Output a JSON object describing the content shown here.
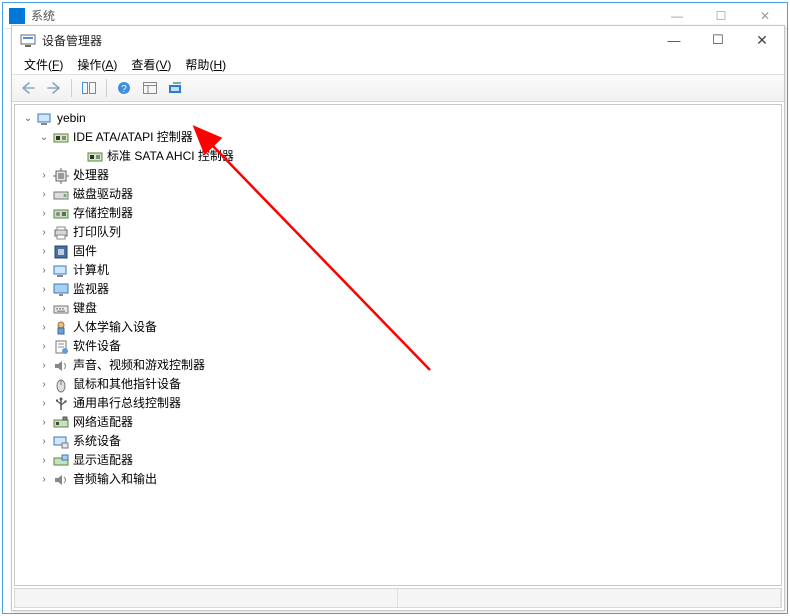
{
  "outer": {
    "title": "系统"
  },
  "inner": {
    "title": "设备管理器"
  },
  "menu": {
    "file": {
      "label": "文件",
      "accel": "F"
    },
    "action": {
      "label": "操作",
      "accel": "A"
    },
    "view": {
      "label": "查看",
      "accel": "V"
    },
    "help": {
      "label": "帮助",
      "accel": "H"
    }
  },
  "tree": {
    "root": "yebin",
    "items": [
      {
        "id": "ide",
        "label": "IDE ATA/ATAPI 控制器",
        "expanded": true,
        "icon": "ide-icon",
        "children": [
          {
            "id": "sata",
            "label": "标准 SATA AHCI 控制器",
            "icon": "ide-icon"
          }
        ]
      },
      {
        "id": "cpu",
        "label": "处理器",
        "icon": "cpu-icon"
      },
      {
        "id": "disk",
        "label": "磁盘驱动器",
        "icon": "disk-icon"
      },
      {
        "id": "storage",
        "label": "存储控制器",
        "icon": "storage-icon"
      },
      {
        "id": "printq",
        "label": "打印队列",
        "icon": "printer-icon"
      },
      {
        "id": "firmware",
        "label": "固件",
        "icon": "firmware-icon"
      },
      {
        "id": "computer",
        "label": "计算机",
        "icon": "computer-icon"
      },
      {
        "id": "monitor",
        "label": "监视器",
        "icon": "monitor-icon"
      },
      {
        "id": "keyboard",
        "label": "键盘",
        "icon": "keyboard-icon"
      },
      {
        "id": "hid",
        "label": "人体学输入设备",
        "icon": "hid-icon"
      },
      {
        "id": "swdev",
        "label": "软件设备",
        "icon": "software-icon"
      },
      {
        "id": "sound",
        "label": "声音、视频和游戏控制器",
        "icon": "speaker-icon"
      },
      {
        "id": "mouse",
        "label": "鼠标和其他指针设备",
        "icon": "mouse-icon"
      },
      {
        "id": "usb",
        "label": "通用串行总线控制器",
        "icon": "usb-icon"
      },
      {
        "id": "network",
        "label": "网络适配器",
        "icon": "network-icon"
      },
      {
        "id": "system",
        "label": "系统设备",
        "icon": "system-icon"
      },
      {
        "id": "display",
        "label": "显示适配器",
        "icon": "display-icon"
      },
      {
        "id": "audio",
        "label": "音频输入和输出",
        "icon": "speaker-icon"
      }
    ]
  }
}
